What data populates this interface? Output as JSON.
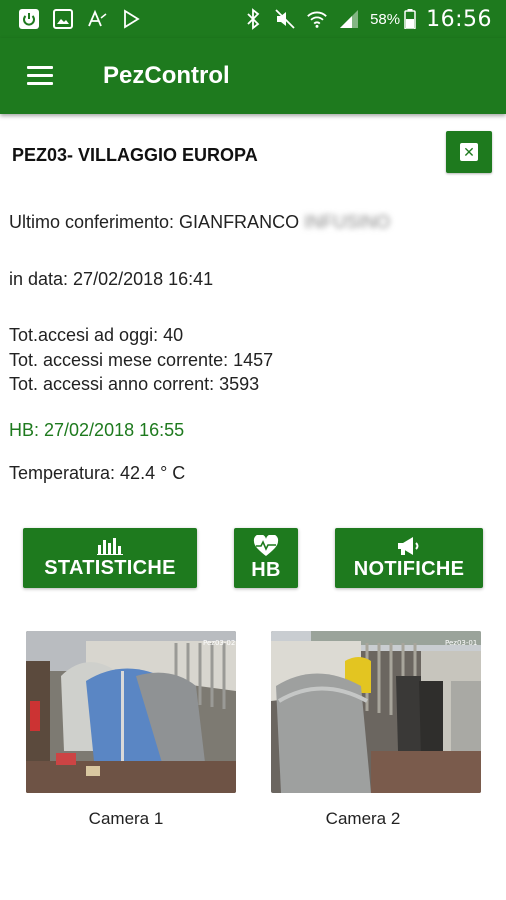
{
  "status_bar": {
    "icons_left": [
      "power-icon",
      "image-icon",
      "font-a-icon",
      "play-store-icon"
    ],
    "icons_right": [
      "bluetooth-icon",
      "mute-icon",
      "wifi-icon",
      "signal-icon"
    ],
    "battery": "58%",
    "time": "16:56"
  },
  "app_bar": {
    "title": "PezControl"
  },
  "site": {
    "title": "PEZ03- VILLAGGIO EUROPA"
  },
  "info": {
    "last_conferral_label": "Ultimo conferimento: GIANFRANCO",
    "last_conferral_surname": "INFUSINO",
    "date": "in data: 27/02/2018 16:41",
    "tot_today": "Tot.accesi ad oggi: 40",
    "tot_month": "Tot. accessi mese corrente: 1457",
    "tot_year": "Tot. accessi anno corrent: 3593",
    "hb": "HB: 27/02/2018 16:55",
    "temperature": "Temperatura: 42.4 ° C"
  },
  "buttons": {
    "statistics": "STATISTICHE",
    "hb": "HB",
    "notifications": "NOTIFICHE"
  },
  "cameras": [
    {
      "label": "Camera 1",
      "overlay": "Pez03-02"
    },
    {
      "label": "Camera 2",
      "overlay": "Pez03-01"
    }
  ],
  "colors": {
    "primary": "#1e7a1e",
    "hb_text": "#1e7a1e"
  }
}
